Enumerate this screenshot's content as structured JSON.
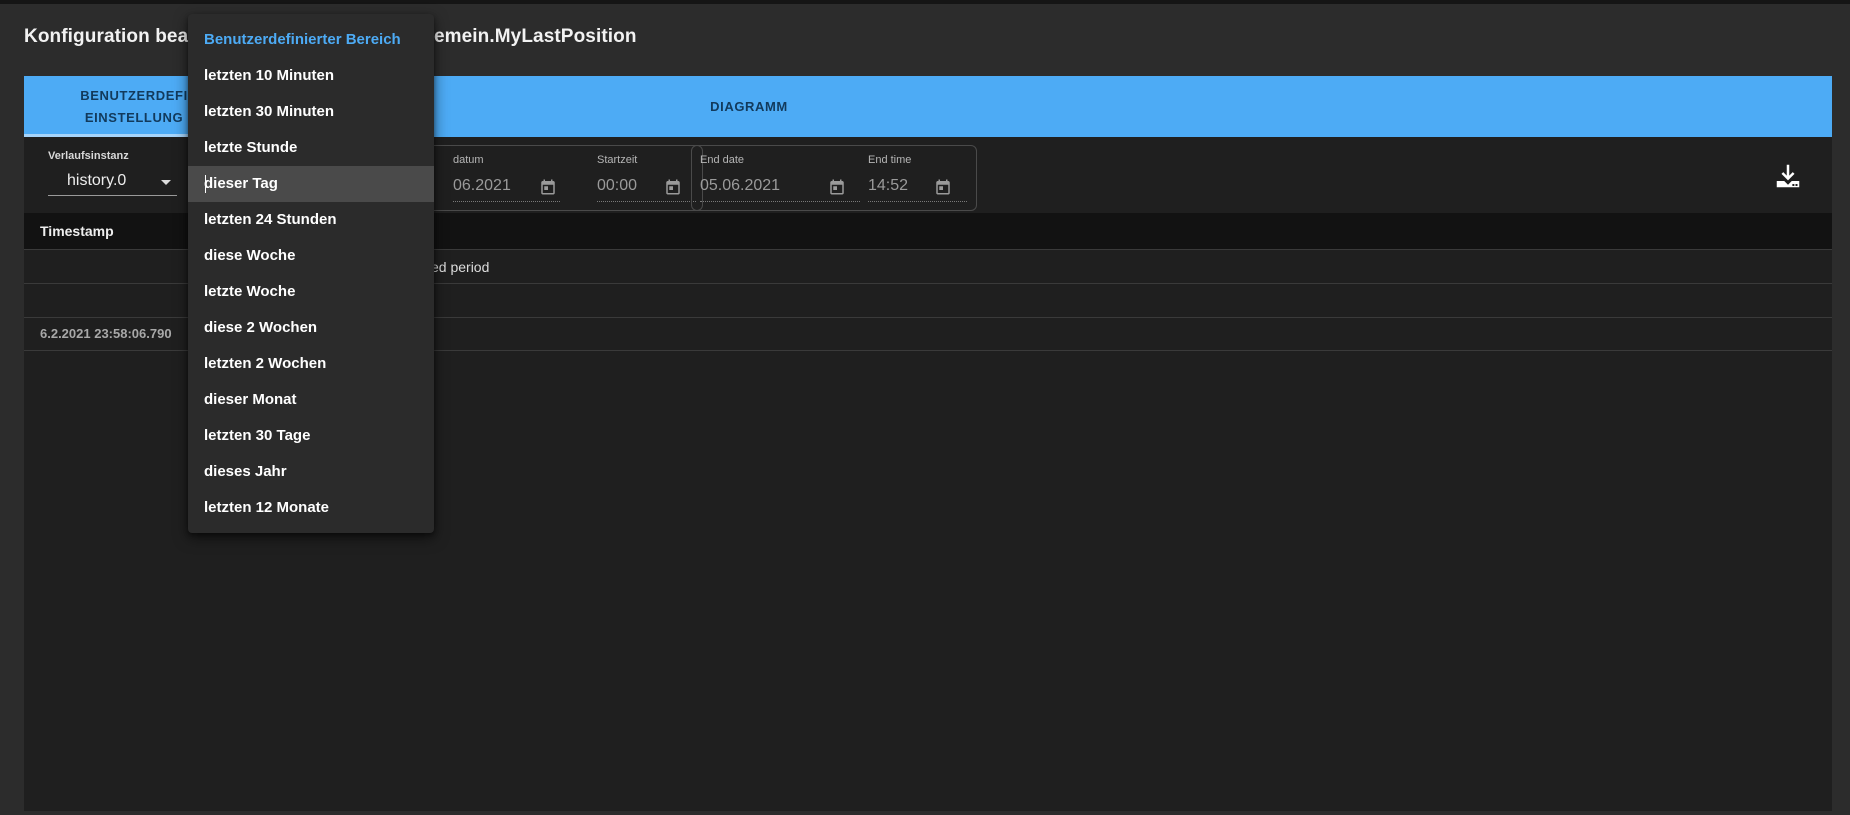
{
  "dialog": {
    "title_left": "Konfiguration bea",
    "title_right": "gemein.MyLastPosition"
  },
  "tabs": [
    {
      "line1": "BENUTZERDEFI",
      "line2": "EINSTELLUNG"
    },
    {
      "label": ""
    },
    {
      "label": "DIAGRAMM"
    }
  ],
  "filters": {
    "instance_label": "Verlaufsinstanz",
    "instance_value": "history.0",
    "start_date_label": "datum",
    "start_date_value": "06.2021",
    "start_time_label": "Startzeit",
    "start_time_value": "00:00",
    "end_date_label": "End date",
    "end_date_value": "05.06.2021",
    "end_time_label": "End time",
    "end_time_value": "14:52"
  },
  "table": {
    "header_timestamp": "Timestamp",
    "rows": [
      {
        "timestamp": "",
        "text": "ed period"
      },
      {
        "timestamp": "",
        "text": ""
      },
      {
        "timestamp": "6.2.2021 23:58:06.790",
        "text": ""
      }
    ]
  },
  "dropdown": {
    "selected_index": 0,
    "focused_index": 4,
    "items": [
      "Benutzerdefinierter Bereich",
      "letzten 10 Minuten",
      "letzten 30 Minuten",
      "letzte Stunde",
      "dieser Tag",
      "letzten 24 Stunden",
      "diese Woche",
      "letzte Woche",
      "diese 2 Wochen",
      "letzten 2 Wochen",
      "dieser Monat",
      "letzten 30 Tage",
      "dieses Jahr",
      "letzten 12 Monate"
    ]
  },
  "colors": {
    "accent": "#4dabf5",
    "tab_text": "#123a5c",
    "panel_bg": "#1f1f1f"
  },
  "icons": {
    "calendar": "calendar-icon",
    "download": "download-icon",
    "select_caret": "chevron-down-icon"
  }
}
